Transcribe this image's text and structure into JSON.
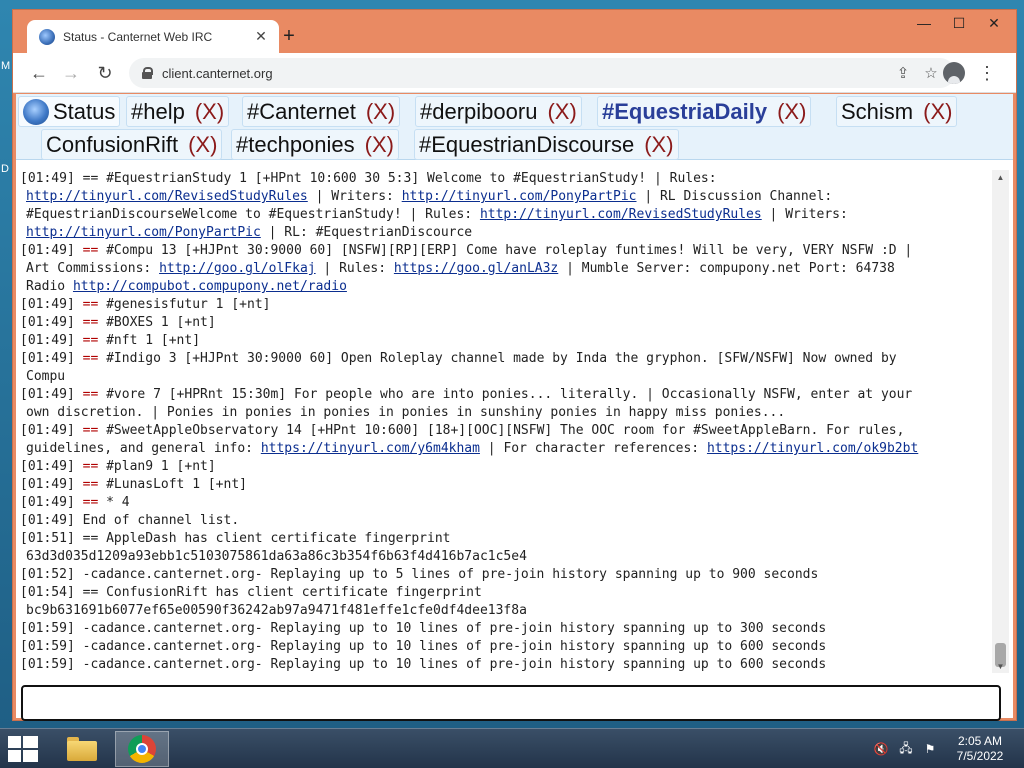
{
  "browser": {
    "tab_title": "Status - Canternet Web IRC",
    "tab_close": "✕",
    "new_tab": "+",
    "url": "client.canternet.org",
    "window_controls": {
      "minimize": "—",
      "maximize": "☐",
      "close": "✕"
    }
  },
  "channel_tabs": [
    {
      "name": "Status",
      "close": "",
      "active": true
    },
    {
      "name": "#help",
      "close": "(X)"
    },
    {
      "name": "#Canternet",
      "close": "(X)"
    },
    {
      "name": "#derpibooru",
      "close": "(X)"
    },
    {
      "name": "#EquestriaDaily",
      "close": "(X)",
      "bold": true
    },
    {
      "name": "Schism",
      "close": "(X)"
    },
    {
      "name": "ConfusionRift",
      "close": "(X)"
    },
    {
      "name": "#techponies",
      "close": "(X)"
    },
    {
      "name": "#EquestrianDiscourse",
      "close": "(X)"
    }
  ],
  "log": [
    {
      "segments": [
        {
          "t": "[01:49] == #EquestrianStudy 1 [+HPnt 10:600 30 5:3] Welcome to #EquestrianStudy! | Rules:"
        }
      ]
    },
    {
      "cont": true,
      "segments": [
        {
          "t": "http://tinyurl.com/RevisedStudyRules",
          "link": true
        },
        {
          "t": " | Writers: "
        },
        {
          "t": "http://tinyurl.com/PonyPartPic",
          "link": true
        },
        {
          "t": " | RL Discussion Channel:"
        }
      ]
    },
    {
      "cont": true,
      "segments": [
        {
          "t": "#EquestrianDiscourseWelcome to #EquestrianStudy! | Rules: "
        },
        {
          "t": "http://tinyurl.com/RevisedStudyRules",
          "link": true
        },
        {
          "t": " | Writers:"
        }
      ]
    },
    {
      "cont": true,
      "segments": [
        {
          "t": "http://tinyurl.com/PonyPartPic",
          "link": true
        },
        {
          "t": " | RL: #EquestrianDiscource"
        }
      ]
    },
    {
      "segments": [
        {
          "t": "[01:49] "
        },
        {
          "t": "==",
          "op": true
        },
        {
          "t": " #Compu 13 [+HJPnt 30:9000 60] [NSFW][RP][ERP] Come have roleplay funtimes! Will be very, VERY NSFW :D |"
        }
      ]
    },
    {
      "cont": true,
      "segments": [
        {
          "t": "Art Commissions: "
        },
        {
          "t": "http://goo.gl/olFkaj",
          "link": true
        },
        {
          "t": " | Rules: "
        },
        {
          "t": "https://goo.gl/anLA3z",
          "link": true
        },
        {
          "t": " | Mumble Server: compupony.net Port: 64738"
        }
      ]
    },
    {
      "cont": true,
      "segments": [
        {
          "t": "Radio "
        },
        {
          "t": "http://compubot.compupony.net/radio",
          "link": true
        }
      ]
    },
    {
      "segments": [
        {
          "t": "[01:49] "
        },
        {
          "t": "==",
          "op": true
        },
        {
          "t": " #genesisfutur 1 [+nt]"
        }
      ]
    },
    {
      "segments": [
        {
          "t": "[01:49] "
        },
        {
          "t": "==",
          "op": true
        },
        {
          "t": " #BOXES 1 [+nt]"
        }
      ]
    },
    {
      "segments": [
        {
          "t": "[01:49] "
        },
        {
          "t": "==",
          "op": true
        },
        {
          "t": " #nft 1 [+nt]"
        }
      ]
    },
    {
      "segments": [
        {
          "t": "[01:49] "
        },
        {
          "t": "==",
          "op": true
        },
        {
          "t": " #Indigo 3 [+HJPnt 30:9000 60] Open Roleplay channel made by Inda the gryphon. [SFW/NSFW] Now owned by"
        }
      ]
    },
    {
      "cont": true,
      "segments": [
        {
          "t": "Compu"
        }
      ]
    },
    {
      "segments": [
        {
          "t": "[01:49] "
        },
        {
          "t": "==",
          "op": true
        },
        {
          "t": " #vore 7 [+HPRnt 15:30m] For people who are into ponies... literally. | Occasionally NSFW, enter at your"
        }
      ]
    },
    {
      "cont": true,
      "segments": [
        {
          "t": "own discretion. | Ponies in ponies in ponies in ponies in sunshiny ponies in happy miss ponies..."
        }
      ]
    },
    {
      "segments": [
        {
          "t": "[01:49] "
        },
        {
          "t": "==",
          "op": true
        },
        {
          "t": " #SweetAppleObservatory 14 [+HPnt 10:600] [18+][OOC][NSFW] The OOC room for #SweetAppleBarn. For rules,"
        }
      ]
    },
    {
      "cont": true,
      "segments": [
        {
          "t": "guidelines, and general info: "
        },
        {
          "t": "https://tinyurl.com/y6m4kham",
          "link": true
        },
        {
          "t": " | For character references: "
        },
        {
          "t": "https://tinyurl.com/ok9b2bt",
          "link": true
        }
      ]
    },
    {
      "segments": [
        {
          "t": "[01:49] "
        },
        {
          "t": "==",
          "op": true
        },
        {
          "t": " #plan9 1 [+nt]"
        }
      ]
    },
    {
      "segments": [
        {
          "t": "[01:49] "
        },
        {
          "t": "==",
          "op": true
        },
        {
          "t": " #LunasLoft 1 [+nt]"
        }
      ]
    },
    {
      "segments": [
        {
          "t": "[01:49] "
        },
        {
          "t": "==",
          "op": true
        },
        {
          "t": " * 4"
        }
      ]
    },
    {
      "segments": [
        {
          "t": "[01:49] End of channel list."
        }
      ]
    },
    {
      "segments": [
        {
          "t": "[01:51] == AppleDash has client certificate fingerprint"
        }
      ]
    },
    {
      "cont": true,
      "segments": [
        {
          "t": "63d3d035d1209a93ebb1c5103075861da63a86c3b354f6b63f4d416b7ac1c5e4"
        }
      ]
    },
    {
      "segments": [
        {
          "t": "[01:52] -cadance.canternet.org- Replaying up to 5 lines of pre-join history spanning up to 900 seconds"
        }
      ]
    },
    {
      "segments": [
        {
          "t": "[01:54] == ConfusionRift has client certificate fingerprint"
        }
      ]
    },
    {
      "cont": true,
      "segments": [
        {
          "t": "bc9b631691b6077ef65e00590f36242ab97a9471f481effe1cfe0df4dee13f8a"
        }
      ]
    },
    {
      "segments": [
        {
          "t": "[01:59] -cadance.canternet.org- Replaying up to 10 lines of pre-join history spanning up to 300 seconds"
        }
      ]
    },
    {
      "segments": [
        {
          "t": "[01:59] -cadance.canternet.org- Replaying up to 10 lines of pre-join history spanning up to 600 seconds"
        }
      ]
    },
    {
      "segments": [
        {
          "t": "[01:59] -cadance.canternet.org- Replaying up to 10 lines of pre-join history spanning up to 600 seconds"
        }
      ]
    }
  ],
  "input": {
    "value": ""
  },
  "taskbar": {
    "clock_time": "2:05 AM",
    "clock_date": "7/5/2022"
  },
  "colors": {
    "window_frame": "#e98a63",
    "link": "#0b2e8f",
    "op": "#b00000",
    "tab_close": "#8b1a1a"
  }
}
